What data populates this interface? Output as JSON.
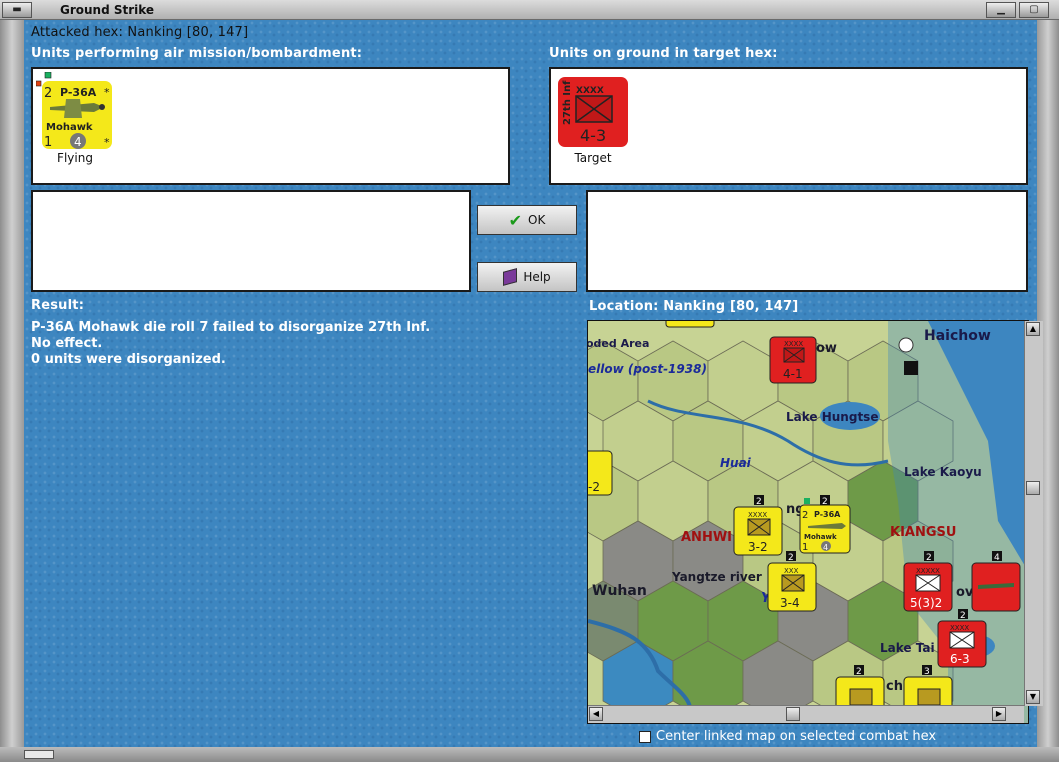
{
  "window": {
    "title": "Ground Strike"
  },
  "header": {
    "attacked_hex": "Attacked hex: Nanking  [80, 147]"
  },
  "left_panel": {
    "label": "Units performing air mission/bombardment:",
    "units": [
      {
        "number": "2",
        "name": "P-36A",
        "nick": "Mohawk",
        "bottom_left": "1",
        "circled": "4",
        "star": "*",
        "caption": "Flying"
      }
    ]
  },
  "right_panel": {
    "label": "Units on ground in target hex:",
    "units": [
      {
        "size": "XXXX",
        "name": "27th Inf",
        "strength": "4-3",
        "caption": "Target"
      }
    ]
  },
  "buttons": {
    "ok": "OK",
    "help": "Help"
  },
  "result": {
    "label": "Result:",
    "lines": [
      "P-36A Mohawk die roll 7 failed to disorganize 27th Inf.",
      "No effect.",
      "0 units were disorganized."
    ]
  },
  "location": {
    "label": "Location:  Nanking  [80, 147]"
  },
  "map": {
    "place_labels": [
      "Haichow",
      "oded Area",
      "ellow (post-1938)",
      "Lake Hungtse",
      "Huai",
      "Lake Kaoyu",
      "ANHWI",
      "KIANGSU",
      "Wuhan",
      "Yangtze river",
      "Lake Tai",
      "ow",
      "ov",
      "ng",
      "ch",
      "Y"
    ],
    "counters": [
      {
        "label": "4-1",
        "size": "XXXX",
        "color": "#e02020"
      },
      {
        "label": "3-2",
        "size": "XXXX",
        "color": "#f4e81a"
      },
      {
        "label": "3-4",
        "size": "XXX",
        "color": "#f4e81a"
      },
      {
        "label": "5(3)2",
        "size": "XXXXX",
        "color": "#e02020"
      },
      {
        "label": "6-3",
        "size": "XXXX",
        "color": "#e02020"
      },
      {
        "label": "-2",
        "size": "",
        "color": "#f4e81a"
      }
    ],
    "air_counter": {
      "number": "2",
      "name": "P-36A",
      "nick": "Mohawk",
      "bottom_left": "1",
      "circled": "4"
    },
    "stack_numbers": [
      "2",
      "2",
      "2",
      "2",
      "4",
      "2",
      "2",
      "3"
    ]
  },
  "footer": {
    "checkbox_label": "Center linked map on selected combat hex"
  },
  "colors": {
    "background": "#3d86c0",
    "allied_counter": "#f4e81a",
    "japan_counter": "#e02020"
  }
}
